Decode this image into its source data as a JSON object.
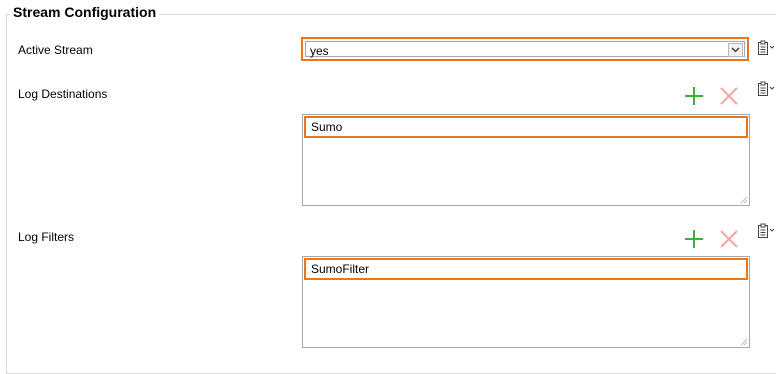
{
  "group": {
    "title": "Stream Configuration"
  },
  "active_stream": {
    "label": "Active Stream",
    "value": "yes"
  },
  "log_destinations": {
    "label": "Log Destinations",
    "items": [
      "Sumo"
    ]
  },
  "log_filters": {
    "label": "Log Filters",
    "items": [
      "SumoFilter"
    ]
  },
  "colors": {
    "highlight_border": "#e87722",
    "add_icon": "#3cb23c",
    "remove_icon": "#f4a6a6"
  },
  "icons": {
    "add": "plus-icon",
    "remove": "x-icon",
    "clipboard": "clipboard-icon",
    "dropdown": "chevron-down-icon"
  }
}
